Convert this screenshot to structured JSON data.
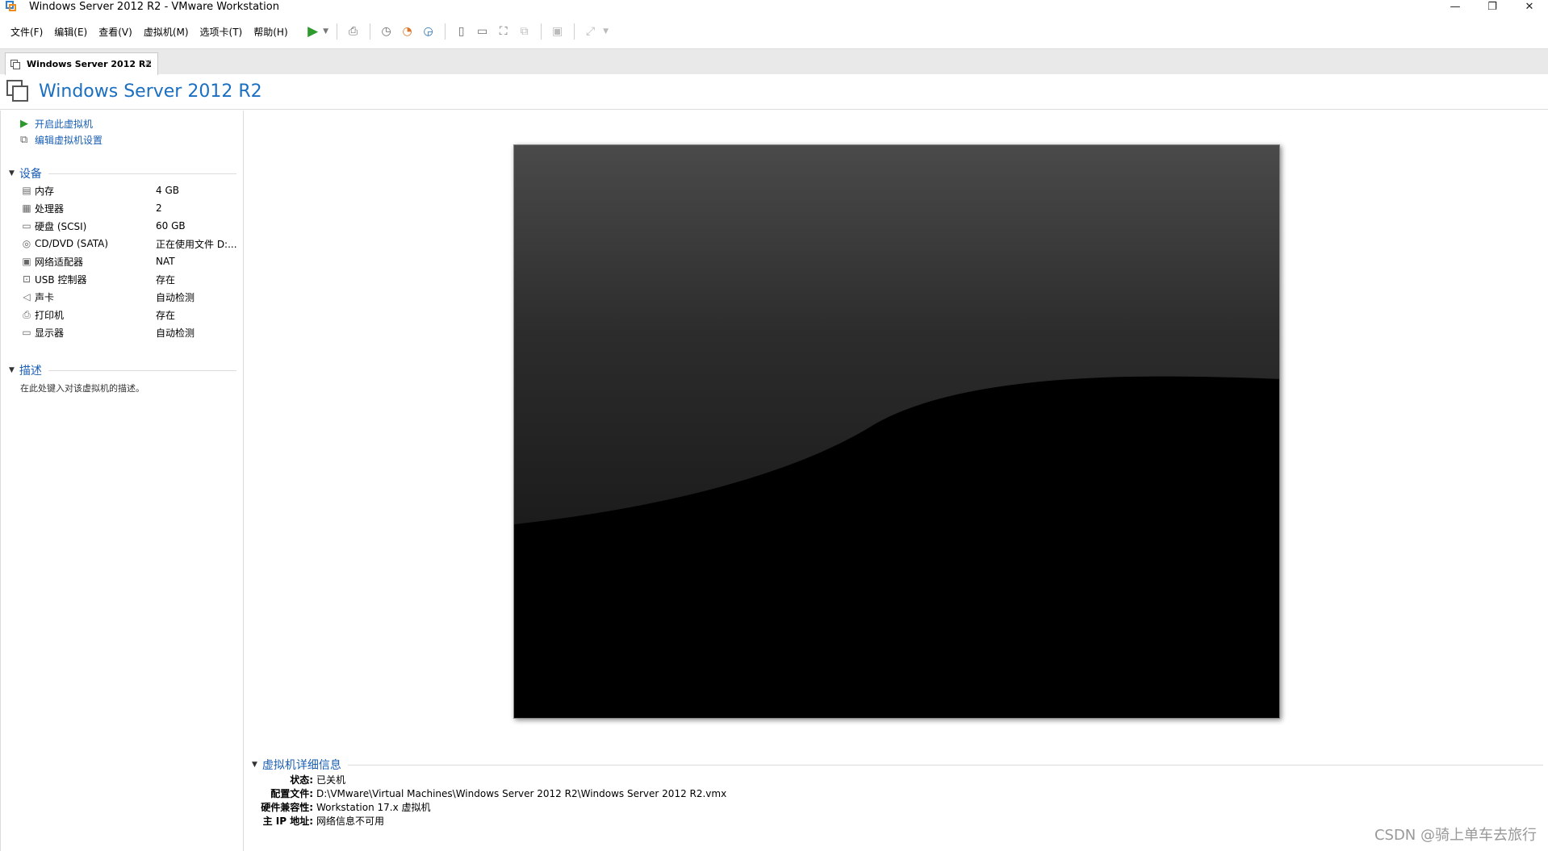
{
  "window": {
    "title": "Windows Server 2012 R2 - VMware Workstation",
    "minimize": "—",
    "restore": "❐",
    "close": "✕"
  },
  "menu": [
    "文件(F)",
    "编辑(E)",
    "查看(V)",
    "虚拟机(M)",
    "选项卡(T)",
    "帮助(H)"
  ],
  "tab": {
    "label": "Windows Server 2012 R2",
    "close": "×"
  },
  "header": {
    "title": "Windows Server 2012 R2"
  },
  "actions": {
    "power_on": "开启此虚拟机",
    "edit_settings": "编辑虚拟机设置"
  },
  "devices": {
    "title": "设备",
    "items": [
      {
        "name": "内存",
        "value": "4 GB",
        "icon": "memory-icon"
      },
      {
        "name": "处理器",
        "value": "2",
        "icon": "cpu-icon"
      },
      {
        "name": "硬盘 (SCSI)",
        "value": "60 GB",
        "icon": "harddisk-icon"
      },
      {
        "name": "CD/DVD (SATA)",
        "value": "正在使用文件 D:...",
        "icon": "cdrom-icon"
      },
      {
        "name": "网络适配器",
        "value": "NAT",
        "icon": "network-icon"
      },
      {
        "name": "USB 控制器",
        "value": "存在",
        "icon": "usb-icon"
      },
      {
        "name": "声卡",
        "value": "自动检测",
        "icon": "sound-icon"
      },
      {
        "name": "打印机",
        "value": "存在",
        "icon": "printer-icon"
      },
      {
        "name": "显示器",
        "value": "自动检测",
        "icon": "display-icon"
      }
    ]
  },
  "description": {
    "title": "描述",
    "placeholder": "在此处键入对该虚拟机的描述。"
  },
  "details": {
    "title": "虚拟机详细信息",
    "rows": [
      {
        "key": "状态:",
        "value": "已关机"
      },
      {
        "key": "配置文件:",
        "value": "D:\\VMware\\Virtual Machines\\Windows Server 2012 R2\\Windows Server 2012 R2.vmx"
      },
      {
        "key": "硬件兼容性:",
        "value": "Workstation 17.x 虚拟机"
      },
      {
        "key": "主 IP 地址:",
        "value": "网络信息不可用"
      }
    ]
  },
  "watermark": "CSDN @骑上单车去旅行",
  "colors": {
    "accent": "#1a6fc2",
    "link": "#1a5fb4",
    "play": "#2e9a2e"
  }
}
